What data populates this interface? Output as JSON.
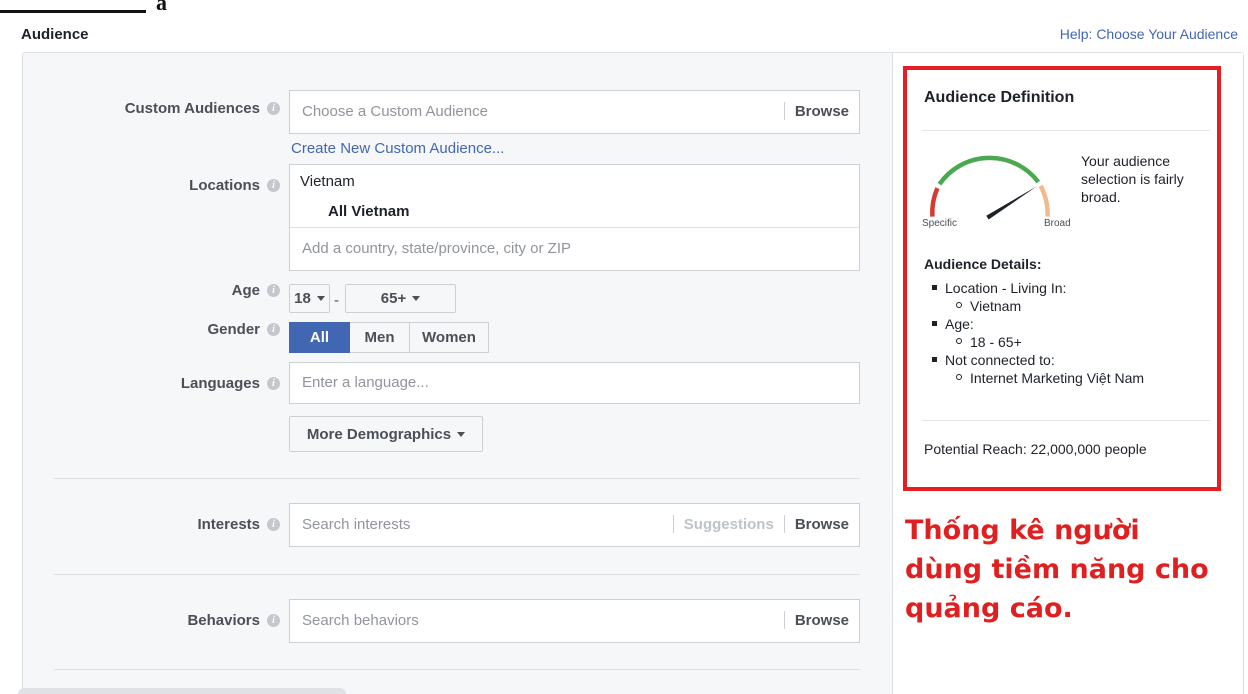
{
  "heading": {
    "title": "Audience",
    "help_link": "Help: Choose Your Audience"
  },
  "custom_audiences": {
    "label": "Custom Audiences",
    "placeholder": "Choose a Custom Audience",
    "browse": "Browse",
    "create_link": "Create New Custom Audience..."
  },
  "locations": {
    "label": "Locations",
    "country": "Vietnam",
    "region": "All Vietnam",
    "placeholder": "Add a country, state/province, city or ZIP"
  },
  "age": {
    "label": "Age",
    "min": "18",
    "separator": "-",
    "max": "65+"
  },
  "gender": {
    "label": "Gender",
    "options": [
      "All",
      "Men",
      "Women"
    ],
    "selected": "All"
  },
  "languages": {
    "label": "Languages",
    "placeholder": "Enter a language..."
  },
  "more_demographics": "More Demographics",
  "interests": {
    "label": "Interests",
    "placeholder": "Search interests",
    "suggestions": "Suggestions",
    "browse": "Browse"
  },
  "behaviors": {
    "label": "Behaviors",
    "placeholder": "Search behaviors",
    "browse": "Browse"
  },
  "definition": {
    "title": "Audience Definition",
    "specific": "Specific",
    "broad": "Broad",
    "summary": "Your audience selection is fairly broad.",
    "details_title": "Audience Details:",
    "location_head": "Location - Living In:",
    "location_value": "Vietnam",
    "age_head": "Age:",
    "age_value": "18 - 65+",
    "not_connected_head": "Not connected to:",
    "not_connected_value": "Internet Marketing Việt Nam",
    "potential_reach": "Potential Reach: 22,000,000 people",
    "gauge_level": 0.82
  },
  "annotation": "Thống kê người dùng tiềm năng cho quảng cáo.",
  "colors": {
    "accent": "#4267b2",
    "highlight": "#e81c24",
    "annotation_text": "#e02020",
    "gauge_green": "#4aa84f",
    "gauge_red": "#d63a30",
    "gauge_orange": "#f2ba8c"
  },
  "icons": {
    "info": "info-icon",
    "dropdown": "caret-down-icon"
  }
}
